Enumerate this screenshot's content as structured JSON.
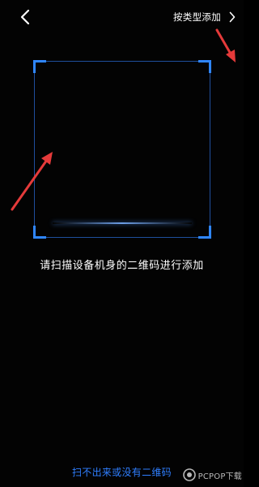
{
  "header": {
    "back_icon": "chevron-left-icon",
    "add_by_type_label": "按类型添加",
    "forward_icon": "chevron-right-icon"
  },
  "scanner": {
    "frame_color": "#2f86ff",
    "instruction": "请扫描设备机身的二维码进行添加"
  },
  "footer": {
    "no_code_link": "扫不出来或没有二维码"
  },
  "annotations": {
    "arrow_color": "#e53a3a"
  },
  "watermark": {
    "text": "PCPOP下载"
  }
}
